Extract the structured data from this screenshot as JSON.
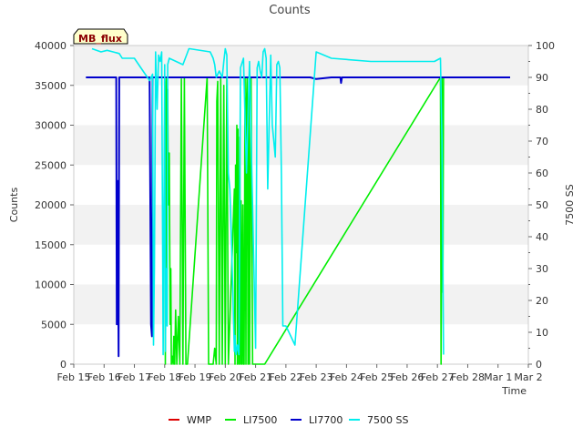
{
  "chart_data": {
    "type": "line",
    "title": "Counts",
    "badge": "MB_flux",
    "xlabel": "Time",
    "ylabel": "Counts",
    "y2label": "7500 SS",
    "xlim": [
      0,
      15
    ],
    "ylim": [
      0,
      40000
    ],
    "y2lim": [
      0,
      100
    ],
    "x_ticks": [
      {
        "value": 0,
        "label": "Feb 15"
      },
      {
        "value": 1,
        "label": "Feb 16"
      },
      {
        "value": 2,
        "label": "Feb 17"
      },
      {
        "value": 3,
        "label": "Feb 18"
      },
      {
        "value": 4,
        "label": "Feb 19"
      },
      {
        "value": 5,
        "label": "Feb 20"
      },
      {
        "value": 6,
        "label": "Feb 21"
      },
      {
        "value": 7,
        "label": "Feb 22"
      },
      {
        "value": 8,
        "label": "Feb 23"
      },
      {
        "value": 9,
        "label": "Feb 24"
      },
      {
        "value": 10,
        "label": "Feb 25"
      },
      {
        "value": 11,
        "label": "Feb 26"
      },
      {
        "value": 12,
        "label": "Feb 27"
      },
      {
        "value": 13,
        "label": "Feb 28"
      },
      {
        "value": 14,
        "label": "Mar 1"
      },
      {
        "value": 15,
        "label": "Mar 2"
      }
    ],
    "y_ticks": [
      0,
      5000,
      10000,
      15000,
      20000,
      25000,
      30000,
      35000,
      40000
    ],
    "y2_ticks": [
      0,
      10,
      20,
      30,
      40,
      50,
      60,
      70,
      80,
      90,
      100
    ],
    "grid": "horizontal bands",
    "legend_placement": "bottom",
    "series": [
      {
        "name": "WMP",
        "color": "#dd0000",
        "axis": "left",
        "x": [],
        "y": []
      },
      {
        "name": "LI7500",
        "color": "#00ee00",
        "axis": "left",
        "x": [
          3.0,
          3.02,
          3.05,
          3.08,
          3.1,
          3.12,
          3.15,
          3.18,
          3.2,
          3.22,
          3.25,
          3.28,
          3.3,
          3.33,
          3.36,
          3.4,
          3.45,
          3.5,
          3.55,
          3.6,
          3.65,
          3.7,
          3.72,
          3.75,
          4.4,
          4.45,
          4.5,
          4.6,
          4.65,
          4.7,
          4.72,
          4.75,
          4.8,
          4.85,
          4.9,
          4.95,
          5.0,
          5.05,
          5.1,
          5.3,
          5.32,
          5.34,
          5.36,
          5.38,
          5.4,
          5.42,
          5.45,
          5.48,
          5.5,
          5.52,
          5.55,
          5.58,
          5.6,
          5.62,
          5.65,
          5.68,
          5.7,
          5.72,
          5.75,
          5.78,
          5.8,
          5.85,
          5.9,
          5.95,
          6.0,
          6.05,
          6.1,
          6.15,
          6.2,
          6.25,
          6.3,
          12.1,
          12.12,
          12.15,
          12.18,
          12.2,
          12.22
        ],
        "y": [
          35500,
          0,
          35800,
          12000,
          34500,
          20000,
          26500,
          5000,
          12000,
          0,
          1000,
          0,
          3500,
          0,
          6800,
          0,
          6000,
          0,
          35800,
          0,
          36000,
          0,
          0,
          0,
          36000,
          0,
          0,
          0,
          2000,
          0,
          33000,
          35500,
          0,
          35800,
          0,
          35000,
          0,
          36000,
          0,
          22000,
          0,
          25000,
          14000,
          30000,
          0,
          29500,
          0,
          28500,
          0,
          20500,
          0,
          20000,
          0,
          0,
          36000,
          0,
          33000,
          36000,
          0,
          34500,
          0,
          36000,
          0,
          0,
          0,
          0,
          0,
          0,
          0,
          0,
          0,
          36000,
          0,
          36000,
          9000,
          36000,
          36000
        ]
      },
      {
        "name": "LI7700",
        "color": "#0000cc",
        "axis": "left",
        "x": [
          0.4,
          1.4,
          1.42,
          1.45,
          1.48,
          1.5,
          1.52,
          1.55,
          2.5,
          2.55,
          2.58,
          2.6,
          2.62,
          2.65,
          2.7,
          2.8,
          2.9,
          3.0,
          5.5,
          5.6,
          5.7,
          7.8,
          8.0,
          8.5,
          8.8,
          8.82,
          8.85,
          9.0,
          14.4
        ],
        "y": [
          36000,
          36000,
          5000,
          23000,
          1000,
          36000,
          36000,
          36000,
          36000,
          5000,
          3500,
          36000,
          36000,
          36000,
          36000,
          36000,
          36000,
          36000,
          36000,
          36000,
          36000,
          36000,
          35800,
          36000,
          36000,
          35300,
          36000,
          36000,
          36000
        ]
      },
      {
        "name": "7500 SS",
        "color": "#00eeee",
        "axis": "right",
        "x": [
          0.6,
          0.9,
          1.1,
          1.3,
          1.5,
          1.6,
          2.0,
          2.5,
          2.6,
          2.63,
          2.66,
          2.7,
          2.75,
          2.8,
          2.85,
          2.9,
          2.95,
          3.0,
          3.02,
          3.05,
          3.08,
          3.1,
          3.15,
          3.6,
          3.8,
          3.82,
          4.5,
          4.55,
          4.6,
          4.65,
          4.7,
          4.8,
          4.85,
          4.9,
          4.95,
          5.0,
          5.05,
          5.1,
          5.15,
          5.2,
          5.3,
          5.32,
          5.35,
          5.4,
          5.45,
          5.5,
          5.6,
          5.7,
          5.8,
          6.0,
          6.05,
          6.1,
          6.15,
          6.2,
          6.25,
          6.3,
          6.35,
          6.4,
          6.5,
          6.55,
          6.6,
          6.65,
          6.7,
          6.75,
          6.8,
          6.85,
          6.9,
          7.0,
          7.3,
          8.0,
          8.5,
          9.8,
          11.9,
          12.1,
          12.15,
          12.2
        ],
        "y": [
          99,
          98,
          98.5,
          98,
          97.5,
          96,
          96,
          89,
          91,
          6,
          30,
          98,
          80,
          97,
          95,
          98,
          3,
          94,
          4,
          30,
          12,
          94,
          96,
          94,
          99,
          99,
          98,
          97,
          96,
          94,
          90,
          92,
          91,
          90,
          95,
          99,
          97,
          60,
          55,
          40,
          4,
          9,
          3,
          6,
          3,
          93,
          96,
          60,
          95,
          5,
          93,
          95,
          92,
          90,
          98,
          99,
          96,
          55,
          97,
          75,
          70,
          65,
          94,
          95,
          93,
          60,
          12,
          12,
          6,
          98,
          96,
          95,
          95,
          96,
          70,
          3
        ]
      }
    ]
  }
}
